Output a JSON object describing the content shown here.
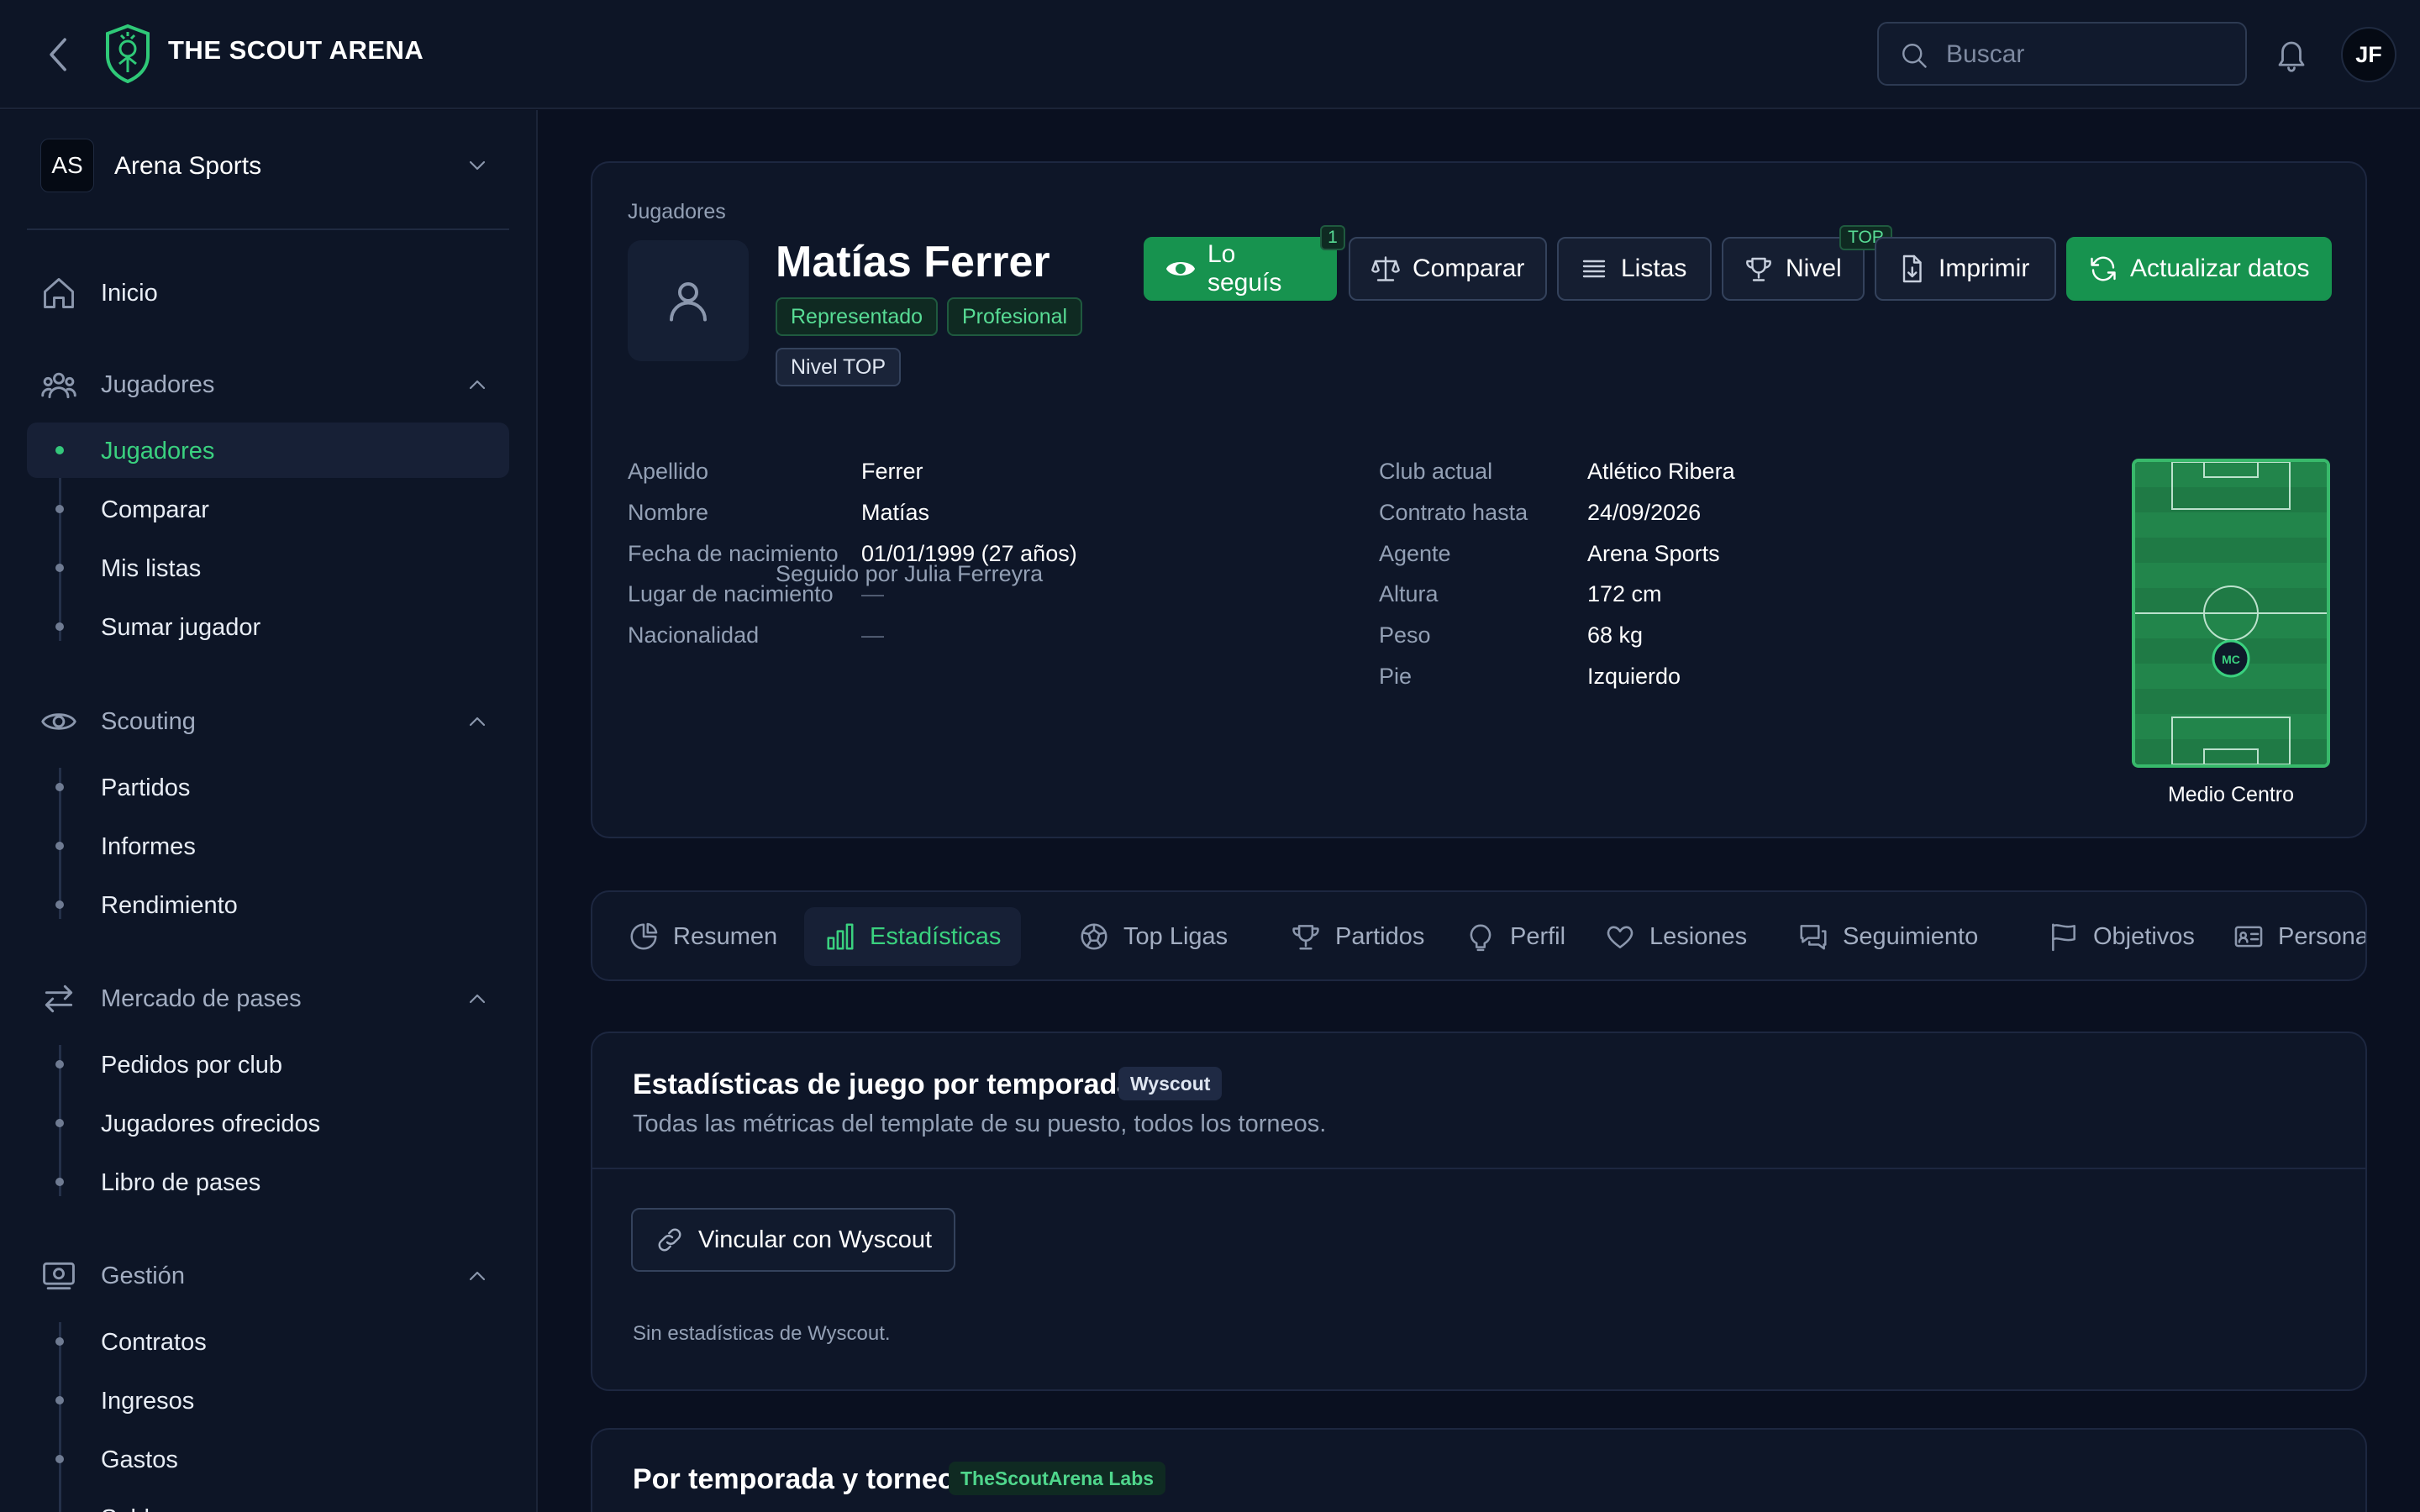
{
  "header": {
    "brand": "THE SCOUT ARENA",
    "search_placeholder": "Buscar",
    "user_initials": "JF"
  },
  "sidebar": {
    "org": {
      "initials": "AS",
      "name": "Arena Sports"
    },
    "home": "Inicio",
    "groups": [
      {
        "label": "Jugadores",
        "items": [
          "Jugadores",
          "Comparar",
          "Mis listas",
          "Sumar jugador"
        ]
      },
      {
        "label": "Scouting",
        "items": [
          "Partidos",
          "Informes",
          "Rendimiento"
        ]
      },
      {
        "label": "Mercado de pases",
        "items": [
          "Pedidos por club",
          "Jugadores ofrecidos",
          "Libro de pases"
        ]
      },
      {
        "label": "Gestión",
        "items": [
          "Contratos",
          "Ingresos",
          "Gastos",
          "Saldos"
        ]
      }
    ],
    "active_item": "Jugadores"
  },
  "profile": {
    "breadcrumb": "Jugadores",
    "name": "Matías Ferrer",
    "tags": [
      "Representado",
      "Profesional",
      "Nivel TOP"
    ],
    "followed_by": "Seguido por Julia Ferreyra",
    "actions": {
      "follow": "Lo seguís",
      "follow_count": "1",
      "compare": "Comparar",
      "lists": "Listas",
      "level": "Nivel",
      "level_badge": "TOP",
      "print": "Imprimir",
      "update": "Actualizar datos"
    },
    "left_fields": [
      {
        "label": "Apellido",
        "value": "Ferrer"
      },
      {
        "label": "Nombre",
        "value": "Matías"
      },
      {
        "label": "Fecha de nacimiento",
        "value": "01/01/1999 (27 años)"
      },
      {
        "label": "Lugar de nacimiento",
        "value": "—"
      },
      {
        "label": "Nacionalidad",
        "value": "—"
      }
    ],
    "right_fields": [
      {
        "label": "Club actual",
        "value": "Atlético Ribera"
      },
      {
        "label": "Contrato hasta",
        "value": "24/09/2026"
      },
      {
        "label": "Agente",
        "value": "Arena Sports"
      },
      {
        "label": "Altura",
        "value": "172 cm"
      },
      {
        "label": "Peso",
        "value": "68 kg"
      },
      {
        "label": "Pie",
        "value": "Izquierdo"
      }
    ],
    "position": {
      "code": "MC",
      "label": "Medio Centro"
    }
  },
  "tabs": [
    "Resumen",
    "Estadísticas",
    "Top Ligas",
    "Partidos",
    "Perfil",
    "Lesiones",
    "Seguimiento",
    "Objetivos",
    "Persona"
  ],
  "active_tab": "Estadísticas",
  "stats_section": {
    "title": "Estadísticas de juego por temporada",
    "source": "Wyscout",
    "subtitle": "Todas las métricas del template de su puesto, todos los torneos.",
    "link_button": "Vincular con Wyscout",
    "empty_text": "Sin estadísticas de Wyscout."
  },
  "season_section": {
    "title": "Por temporada y torneo",
    "source": "TheScoutArena Labs"
  },
  "colors": {
    "accent": "#17934f",
    "accent_text": "#3ad17f",
    "background": "#0a1020",
    "panel": "#0e1628"
  }
}
